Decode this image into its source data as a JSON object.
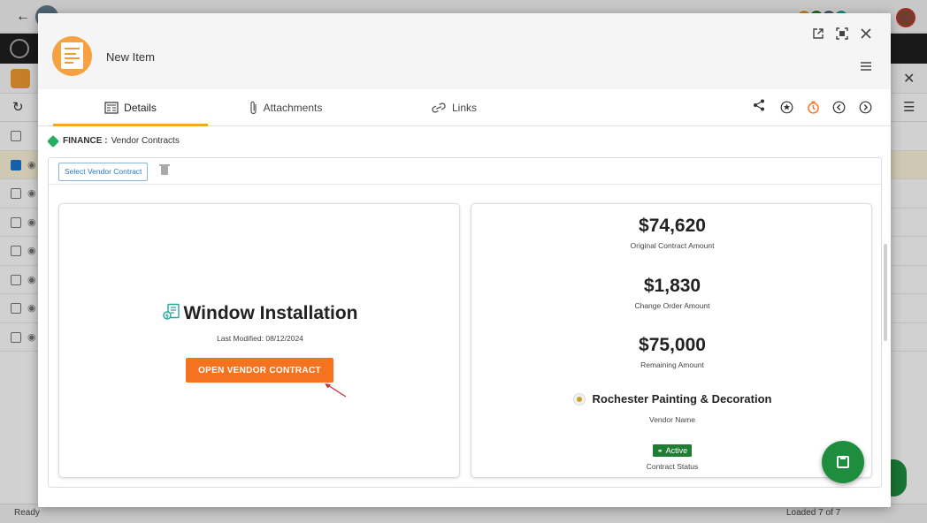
{
  "modal": {
    "title": "New Item"
  },
  "tabs": [
    {
      "label": "Details",
      "active": true
    },
    {
      "label": "Attachments",
      "active": false
    },
    {
      "label": "Links",
      "active": false
    }
  ],
  "breadcrumb": {
    "module": "FINANCE :",
    "section": "Vendor Contracts"
  },
  "toolbar": {
    "select_label": "Select Vendor Contract"
  },
  "contract": {
    "title": "Window Installation",
    "last_modified": "Last Modified: 08/12/2024",
    "open_button": "OPEN VENDOR CONTRACT"
  },
  "amounts": [
    {
      "value": "$74,620",
      "label": "Original Contract Amount"
    },
    {
      "value": "$1,830",
      "label": "Change Order Amount"
    },
    {
      "value": "$75,000",
      "label": "Remaining Amount"
    }
  ],
  "vendor": {
    "name": "Rochester Painting & Decoration",
    "label": "Vendor Name"
  },
  "status": {
    "badge": "Active",
    "label": "Contract Status"
  },
  "background": {
    "status_left": "Ready",
    "status_right": "Loaded 7 of 7"
  },
  "colors": {
    "accent": "#f5731e",
    "tab_underline": "#f5a623",
    "active_badge": "#1e7d33",
    "save_button": "#1e8e3e"
  }
}
